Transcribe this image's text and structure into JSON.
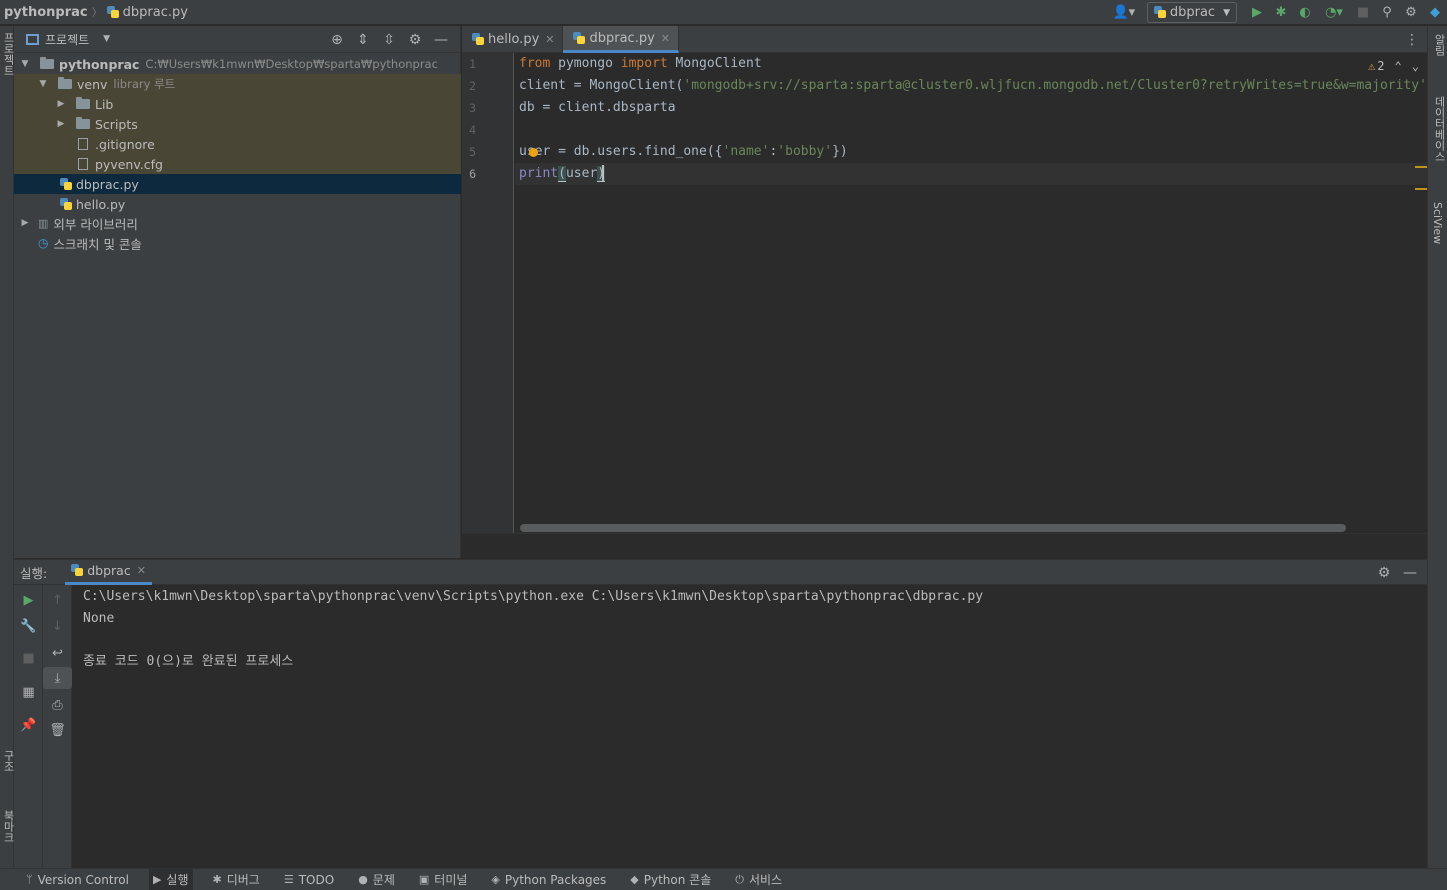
{
  "breadcrumb": {
    "project": "pythonprac",
    "file": "dbprac.py"
  },
  "toolbar": {
    "run_config": "dbprac",
    "user_icon": "user-icon",
    "run_icon": "run-icon",
    "debug_icon": "debug-icon",
    "coverage_icon": "coverage-icon",
    "profile_icon": "profile-icon",
    "stop_icon": "stop-icon",
    "search_icon": "search-icon",
    "settings_icon": "gear-icon"
  },
  "left_strip": {
    "project_label": "프로젝트",
    "structure_label": "구조",
    "bookmarks_label": "북마크"
  },
  "right_strip": {
    "notifications_label": "알림",
    "database_label": "데이터베이스",
    "sciview_label": "SciView"
  },
  "project_panel": {
    "title": "프로젝트",
    "tree": [
      {
        "label": "pythonprac",
        "note": "C:₩Users₩k1mwn₩Desktop₩sparta₩pythonprac"
      },
      {
        "label": "venv",
        "note": "library 루트"
      },
      {
        "label": "Lib"
      },
      {
        "label": "Scripts"
      },
      {
        "label": ".gitignore"
      },
      {
        "label": "pyvenv.cfg"
      },
      {
        "label": "dbprac.py"
      },
      {
        "label": "hello.py"
      },
      {
        "label": "외부 라이브러리"
      },
      {
        "label": "스크래치 및 콘솔"
      }
    ]
  },
  "editor": {
    "tabs": [
      {
        "label": "hello.py"
      },
      {
        "label": "dbprac.py"
      }
    ],
    "warning_count": "2",
    "line_numbers": [
      "1",
      "2",
      "3",
      "4",
      "5",
      "6"
    ],
    "code": {
      "l1_from": "from",
      "l1_mod": " pymongo ",
      "l1_import": "import",
      "l1_rest": " MongoClient",
      "l2_a": "client = MongoClient(",
      "l2_str": "'mongodb+srv://sparta:sparta@cluster0.wljfucn.mongodb.net/Cluster0?retryWrites=true&w=majority'",
      "l3": "db = client.dbsparta",
      "l5_a": "user = db.users.find_one({",
      "l5_s1": "'name'",
      "l5_b": ":",
      "l5_s2": "'bobby'",
      "l5_c": "})",
      "l6_fn": "print",
      "l6_open": "(",
      "l6_arg": "user",
      "l6_close": ")"
    }
  },
  "run_panel": {
    "label": "실행:",
    "tab": "dbprac",
    "output": [
      "C:\\Users\\k1mwn\\Desktop\\sparta\\pythonprac\\venv\\Scripts\\python.exe C:\\Users\\k1mwn\\Desktop\\sparta\\pythonprac\\dbprac.py",
      "None",
      "",
      "종료 코드 0(으)로 완료된 프로세스"
    ]
  },
  "bottom_bar": [
    {
      "label": "Version Control",
      "icon": "branch-icon"
    },
    {
      "label": "실행",
      "icon": "run-icon"
    },
    {
      "label": "디버그",
      "icon": "debug-icon"
    },
    {
      "label": "TODO",
      "icon": "list-icon"
    },
    {
      "label": "문제",
      "icon": "info-icon"
    },
    {
      "label": "터미널",
      "icon": "terminal-icon"
    },
    {
      "label": "Python Packages",
      "icon": "packages-icon"
    },
    {
      "label": "Python 콘솔",
      "icon": "python-icon"
    },
    {
      "label": "서비스",
      "icon": "services-icon"
    }
  ]
}
